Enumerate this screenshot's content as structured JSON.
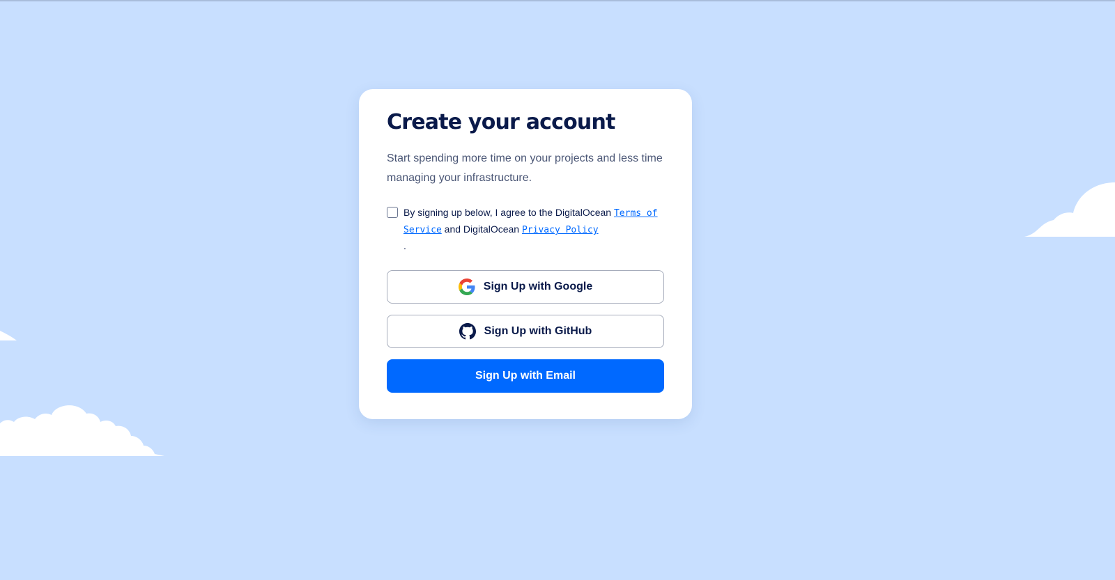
{
  "card": {
    "title": "Create your account",
    "subtitle": "Start spending more time on your projects and less time managing your infrastructure."
  },
  "agreement": {
    "text_before": "By signing up below, I agree to the DigitalOcean ",
    "terms_link": "Terms of Service",
    "text_middle": " and DigitalOcean ",
    "privacy_link": "Privacy Policy",
    "text_after": ".",
    "checked": false
  },
  "buttons": {
    "google_label": "Sign Up with Google",
    "google_icon": "google-icon",
    "github_label": "Sign Up with GitHub",
    "github_icon": "github-icon",
    "email_label": "Sign Up with Email"
  },
  "colors": {
    "background": "#c8dfff",
    "primary": "#0069ff",
    "title": "#0a1a4a"
  }
}
